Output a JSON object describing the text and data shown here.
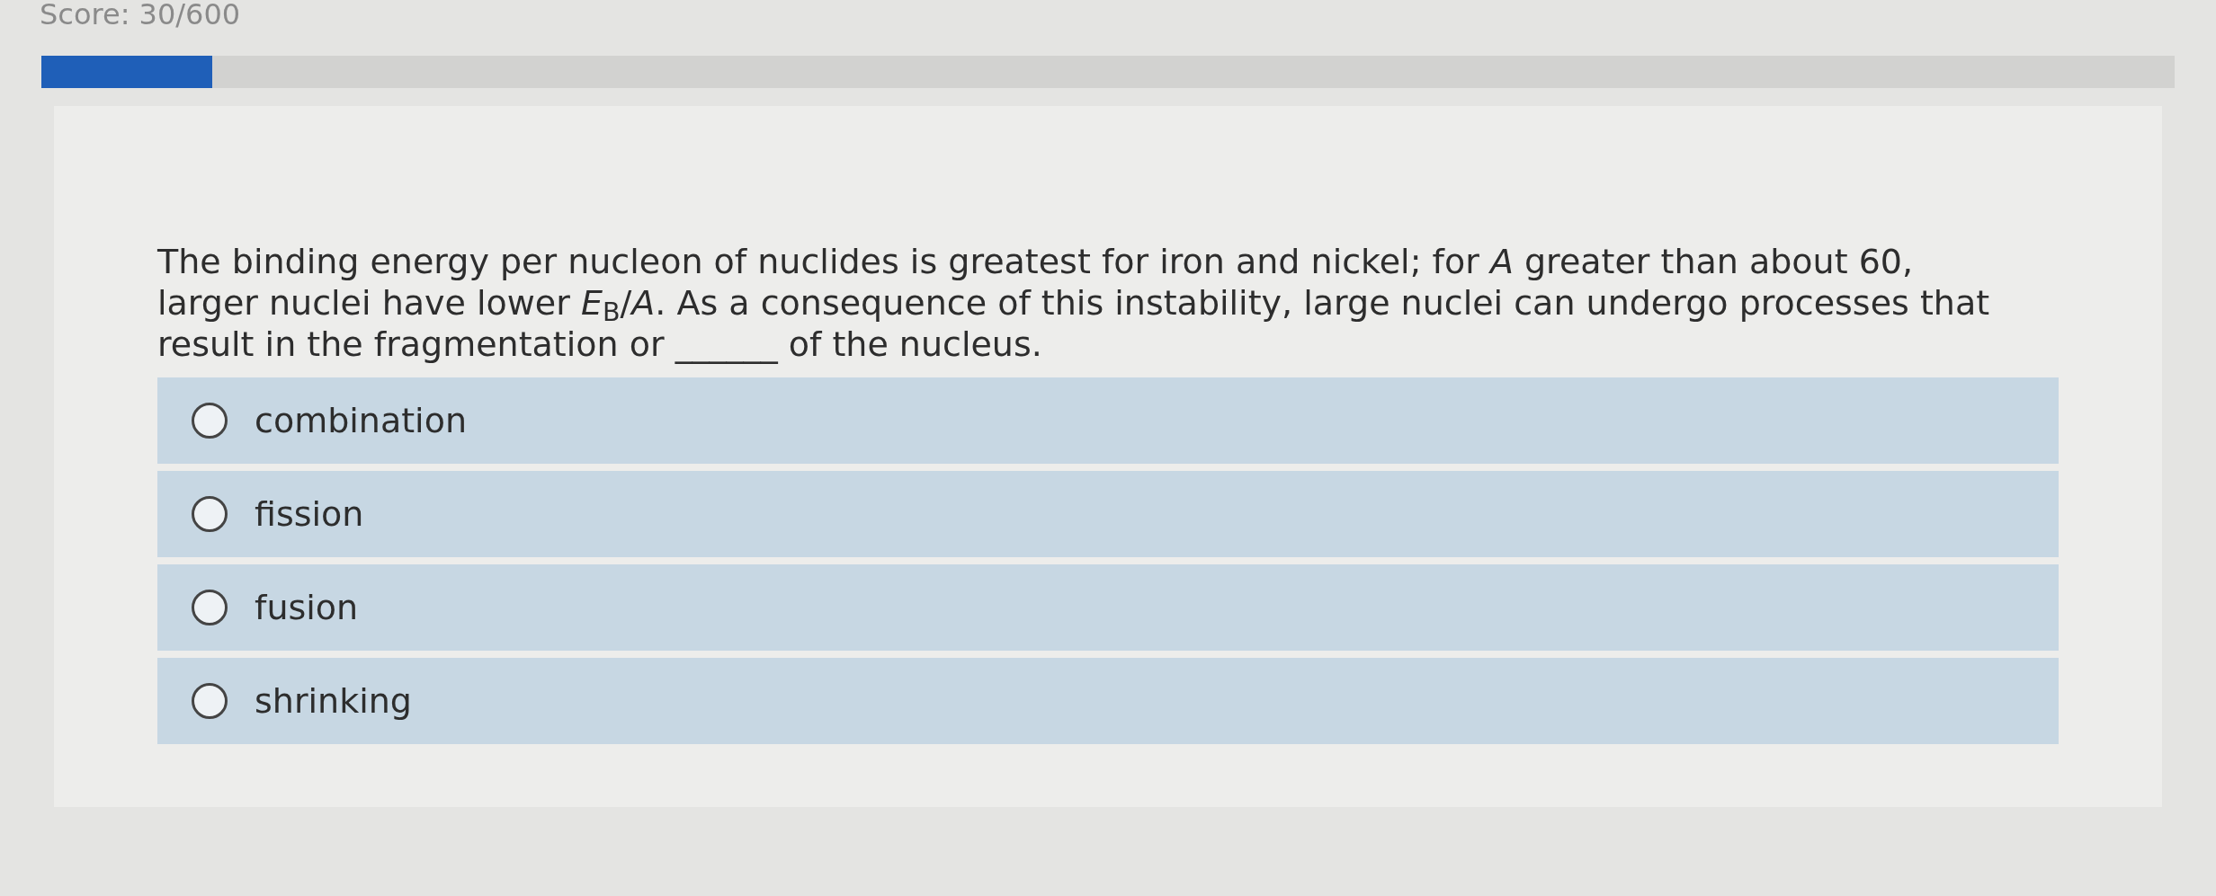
{
  "score": "Score: 30/600",
  "progress": {
    "level": 0.08
  },
  "question": "The binding energy per nucleon of nuclides is greatest for iron and nickel; for *A* greater than about 60, larger nuclei have lower *E*$_{B}$/*A*. As a consequence of this instability, large nuclei can undergo processes that result in the fragmentation or ______ of the nucleus.",
  "options": [
    {
      "label": "combination",
      "selected": false
    },
    {
      "label": "fission",
      "selected": false
    },
    {
      "label": "fusion",
      "selected": false
    },
    {
      "label": "shrinking",
      "selected": false
    }
  ]
}
